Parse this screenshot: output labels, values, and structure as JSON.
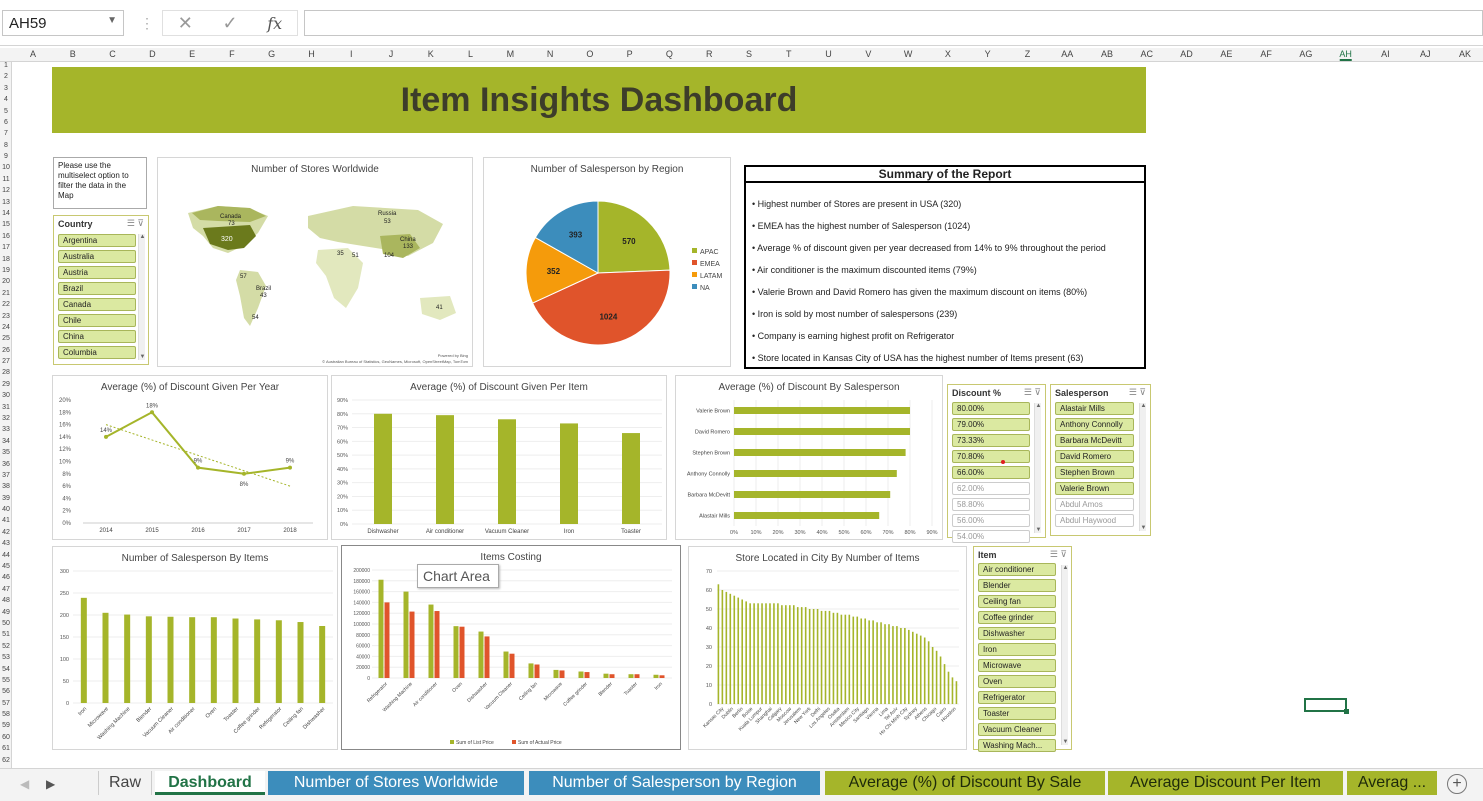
{
  "formula_bar": {
    "name_box": "AH59",
    "cancel_icon": "✕",
    "confirm_icon": "✓",
    "fx_label": "fx",
    "formula": ""
  },
  "columns": [
    "A",
    "B",
    "C",
    "D",
    "E",
    "F",
    "G",
    "H",
    "I",
    "J",
    "K",
    "L",
    "M",
    "N",
    "O",
    "P",
    "Q",
    "R",
    "S",
    "T",
    "U",
    "V",
    "W",
    "X",
    "Y",
    "Z",
    "AA",
    "AB",
    "AC",
    "AD",
    "AE",
    "AF",
    "AG",
    "AH",
    "AI",
    "AJ",
    "AK"
  ],
  "selected_column": "AH",
  "rows": [
    "1",
    "2",
    "3",
    "4",
    "5",
    "6",
    "7",
    "8",
    "9",
    "10",
    "11",
    "12",
    "13",
    "14",
    "15",
    "16",
    "17",
    "18",
    "19",
    "20",
    "21",
    "22",
    "23",
    "24",
    "25",
    "26",
    "27",
    "28",
    "29",
    "30",
    "31",
    "32",
    "33",
    "34",
    "35",
    "36",
    "37",
    "38",
    "39",
    "40",
    "41",
    "42",
    "43",
    "44",
    "45",
    "46",
    "47",
    "48",
    "49",
    "50",
    "51",
    "52",
    "53",
    "54",
    "55",
    "56",
    "57",
    "58",
    "59",
    "60",
    "61",
    "62"
  ],
  "dashboard": {
    "title": "Item Insights Dashboard",
    "note": "Please use the multiselect option to filter the data in the Map"
  },
  "map": {
    "title": "Number of Stores Worldwide",
    "labels": [
      {
        "text": "Canada"
      },
      {
        "text": "73"
      },
      {
        "text": "320"
      },
      {
        "text": "Russia"
      },
      {
        "text": "53"
      },
      {
        "text": "China"
      },
      {
        "text": "133"
      },
      {
        "text": "35"
      },
      {
        "text": "51"
      },
      {
        "text": "104"
      },
      {
        "text": "57"
      },
      {
        "text": "Brazil"
      },
      {
        "text": "43"
      },
      {
        "text": "54"
      },
      {
        "text": "41"
      }
    ],
    "credit1": "Powered by Bing",
    "credit2": "© Australian Bureau of Statistics, GeoNames, Microsoft, OpenStreetMap, TomTom"
  },
  "country_slicer": {
    "header": "Country",
    "items": [
      "Argentina",
      "Australia",
      "Austria",
      "Brazil",
      "Canada",
      "Chile",
      "China",
      "Columbia"
    ]
  },
  "summary": {
    "title": "Summary of the Report",
    "lines": [
      "• Highest number of Stores are present in USA (320)",
      "• EMEA has the highest number of Salesperson (1024)",
      "• Average % of discount given per year decreased from 14% to 9% throughout the period",
      "• Air conditioner is the maximum discounted items (79%)",
      "• Valerie Brown and David Romero has given the maximum discount on items (80%)",
      "• Iron is sold by most number of salespersons (239)",
      "• Company is earning highest profit on Refrigerator",
      "• Store located in Kansas City of USA has the highest number of Items present (63)"
    ]
  },
  "discount_slicer": {
    "header": "Discount %",
    "items": [
      "80.00%",
      "79.00%",
      "73.33%",
      "70.80%",
      "66.00%",
      "62.00%",
      "58.80%",
      "56.00%",
      "54.00%"
    ],
    "selected_count": 5
  },
  "salesperson_slicer": {
    "header": "Salesperson",
    "items": [
      "Alastair Mills",
      "Anthony Connolly",
      "Barbara McDevitt",
      "David Romero",
      "Stephen Brown",
      "Valerie Brown",
      "Abdul Amos",
      "Abdul Haywood"
    ],
    "selected_count": 6
  },
  "item_slicer": {
    "header": "Item",
    "items": [
      "Air conditioner",
      "Blender",
      "Ceiling fan",
      "Coffee grinder",
      "Dishwasher",
      "Iron",
      "Microwave",
      "Oven",
      "Refrigerator",
      "Toaster",
      "Vacuum Cleaner",
      "Washing Mach..."
    ]
  },
  "tooltip": "Chart Area",
  "colors": {
    "olive": "#a5b52a",
    "olive_dark": "#5b6b12",
    "emea": "#e0542b",
    "latam": "#f59b0b",
    "na": "#3c8dbc",
    "red_bar": "#e0542b"
  },
  "chart_data": [
    {
      "type": "pie",
      "title": "Number of Salesperson by Region",
      "categories": [
        "APAC",
        "EMEA",
        "LATAM",
        "NA"
      ],
      "values": [
        570,
        1024,
        352,
        393
      ],
      "colors": [
        "#a5b52a",
        "#e0542b",
        "#f59b0b",
        "#3c8dbc"
      ],
      "legend": "right"
    },
    {
      "type": "line",
      "title": "Average (%) of Discount Given Per Year",
      "x": [
        "2014",
        "2015",
        "2016",
        "2017",
        "2018"
      ],
      "values": [
        14,
        18,
        9,
        8,
        9
      ],
      "value_labels": [
        "14%",
        "18%",
        "9%",
        "8%",
        "9%"
      ],
      "yticks": [
        "0%",
        "2%",
        "4%",
        "6%",
        "8%",
        "10%",
        "12%",
        "14%",
        "16%",
        "18%",
        "20%"
      ],
      "ylim": [
        0,
        20
      ],
      "trendline": true
    },
    {
      "type": "bar",
      "title": "Average (%) of Discount Given Per Item",
      "categories": [
        "Dishwasher",
        "Air conditioner",
        "Vacuum Cleaner",
        "Iron",
        "Toaster"
      ],
      "values": [
        80,
        79,
        76,
        73,
        66
      ],
      "yticks": [
        "0%",
        "10%",
        "20%",
        "30%",
        "40%",
        "50%",
        "60%",
        "70%",
        "80%",
        "90%"
      ],
      "ylim": [
        0,
        90
      ]
    },
    {
      "type": "bar",
      "orientation": "horizontal",
      "title": "Average (%) of Discount By Salesperson",
      "categories": [
        "Valerie Brown",
        "David Romero",
        "Stephen Brown",
        "Anthony Connolly",
        "Barbara McDevitt",
        "Alastair Mills"
      ],
      "values": [
        80,
        80,
        78,
        74,
        71,
        66
      ],
      "xticks": [
        "0%",
        "10%",
        "20%",
        "30%",
        "40%",
        "50%",
        "60%",
        "70%",
        "80%",
        "90%"
      ],
      "xlim": [
        0,
        90
      ]
    },
    {
      "type": "bar",
      "title": "Number of Salesperson By Items",
      "categories": [
        "Iron",
        "Microwave",
        "Washing Machine",
        "Blender",
        "Vacuum Cleaner",
        "Air conditioner",
        "Oven",
        "Toaster",
        "Coffee grinder",
        "Refrigerator",
        "Ceiling fan",
        "Dishwasher"
      ],
      "values": [
        239,
        205,
        201,
        197,
        196,
        195,
        195,
        192,
        190,
        188,
        184,
        175
      ],
      "yticks": [
        "0",
        "50",
        "100",
        "150",
        "200",
        "250",
        "300"
      ],
      "ylim": [
        0,
        300
      ]
    },
    {
      "type": "bar",
      "title": "Items Costing",
      "categories": [
        "Refrigerator",
        "Washing Machine",
        "Air conditioner",
        "Oven",
        "Dishwasher",
        "Vacuum Cleaner",
        "Ceiling fan",
        "Microwave",
        "Coffee grinder",
        "Blender",
        "Toaster",
        "Iron"
      ],
      "series": [
        {
          "name": "Sum of List Price",
          "values": [
            182000,
            160000,
            136000,
            96000,
            86000,
            49000,
            27000,
            15000,
            12000,
            8000,
            7000,
            6000
          ]
        },
        {
          "name": "Sum of Actual Price",
          "values": [
            140000,
            123000,
            124000,
            95000,
            77000,
            45000,
            25000,
            14000,
            11000,
            7000,
            7000,
            5000
          ]
        }
      ],
      "yticks": [
        "0",
        "20000",
        "40000",
        "60000",
        "80000",
        "100000",
        "120000",
        "140000",
        "160000",
        "180000",
        "200000"
      ],
      "ylim": [
        0,
        200000
      ],
      "legend": "bottom"
    },
    {
      "type": "bar",
      "title": "Store Located in City By Number of Items",
      "x_labels": [
        "Kansas City",
        "Dublin",
        "Berlin",
        "Boise",
        "Kuala Lumpur",
        "Shanghai",
        "Calgary",
        "Moscow",
        "Jerusalem",
        "New York",
        "Delhi",
        "Los Angeles",
        "Osaka",
        "Amsterdam",
        "Mexico City",
        "Santiago",
        "Vienna",
        "Lima",
        "Tel Aviv",
        "Ho Chi Minh City",
        "Sydney",
        "Athens",
        "Chicago",
        "Cairo",
        "Houston"
      ],
      "values": [
        63,
        60,
        59,
        58,
        57,
        56,
        55,
        54,
        53,
        53,
        53,
        53,
        53,
        53,
        53,
        53,
        52,
        52,
        52,
        52,
        51,
        51,
        51,
        50,
        50,
        50,
        49,
        49,
        49,
        48,
        48,
        47,
        47,
        47,
        46,
        46,
        45,
        45,
        44,
        44,
        43,
        43,
        42,
        42,
        41,
        41,
        40,
        40,
        39,
        38,
        37,
        36,
        35,
        33,
        30,
        28,
        25,
        21,
        17,
        14,
        12
      ],
      "yticks": [
        "0",
        "10",
        "20",
        "30",
        "40",
        "50",
        "60",
        "70"
      ],
      "ylim": [
        0,
        70
      ]
    }
  ],
  "sheet_tabs": [
    {
      "label": "Raw"
    },
    {
      "label": "Dashboard"
    },
    {
      "label": "Number of Stores Worldwide"
    },
    {
      "label": "Number of Salesperson by Region"
    },
    {
      "label": "Average (%) of Discount By Sale"
    },
    {
      "label": "Average Discount Per Item"
    },
    {
      "label": "Averag ..."
    }
  ],
  "tab_nav": {
    "next": "▶",
    "add": "+"
  }
}
